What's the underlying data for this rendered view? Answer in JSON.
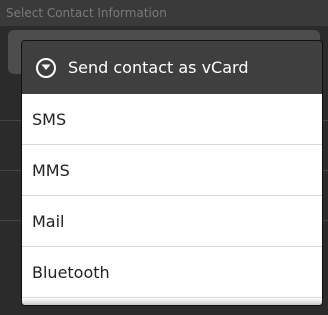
{
  "background": {
    "header_title": "Select Contact Information"
  },
  "dialog": {
    "title": "Send contact as vCard",
    "title_icon": "chevron-down-circle-icon",
    "items": [
      {
        "label": "SMS"
      },
      {
        "label": "MMS"
      },
      {
        "label": "Mail"
      },
      {
        "label": "Bluetooth"
      }
    ]
  },
  "colors": {
    "title_bar": "#3f3f3f",
    "list_background": "#ffffff",
    "divider": "#d8d8d8"
  }
}
